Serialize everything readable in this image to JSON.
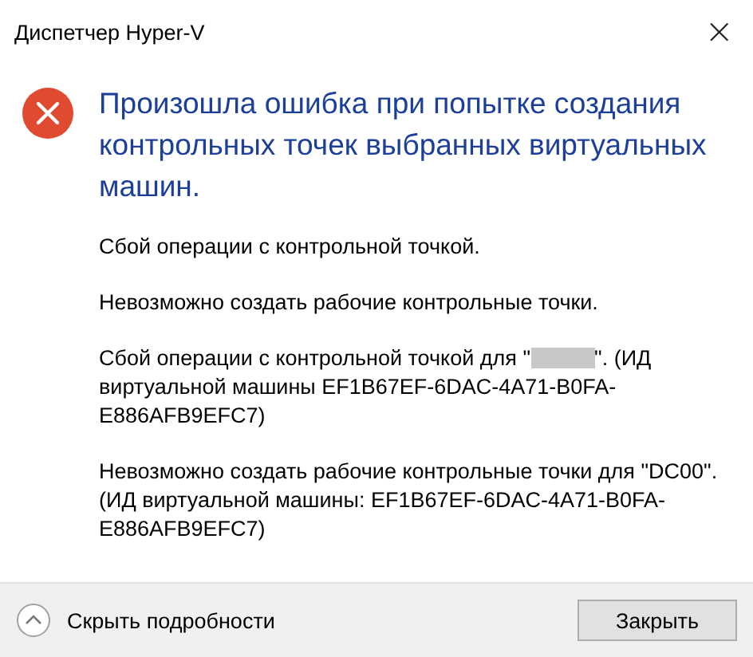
{
  "window": {
    "title": "Диспетчер Hyper-V",
    "close": "×"
  },
  "heading": "Произошла ошибка при попытке создания контрольных точек выбранных виртуальных машин.",
  "details": [
    {
      "text": "Сбой операции с контрольной точкой.",
      "redacted": false
    },
    {
      "text": "Невозможно создать рабочие контрольные точки.",
      "redacted": false
    },
    {
      "text": "Сбой операции с контрольной точкой для \"",
      "redacted": true,
      "text_after": "\". (ИД виртуальной машины EF1B67EF-6DAC-4A71-B0FA-E886AFB9EFC7)"
    },
    {
      "text": "Невозможно создать рабочие контрольные точки для \"DC00\". (ИД виртуальной машины: EF1B67EF-6DAC-4A71-B0FA-E886AFB9EFC7)",
      "redacted": false
    }
  ],
  "footer": {
    "toggle": "Скрыть подробности",
    "expanded": true,
    "button": "Закрыть"
  }
}
